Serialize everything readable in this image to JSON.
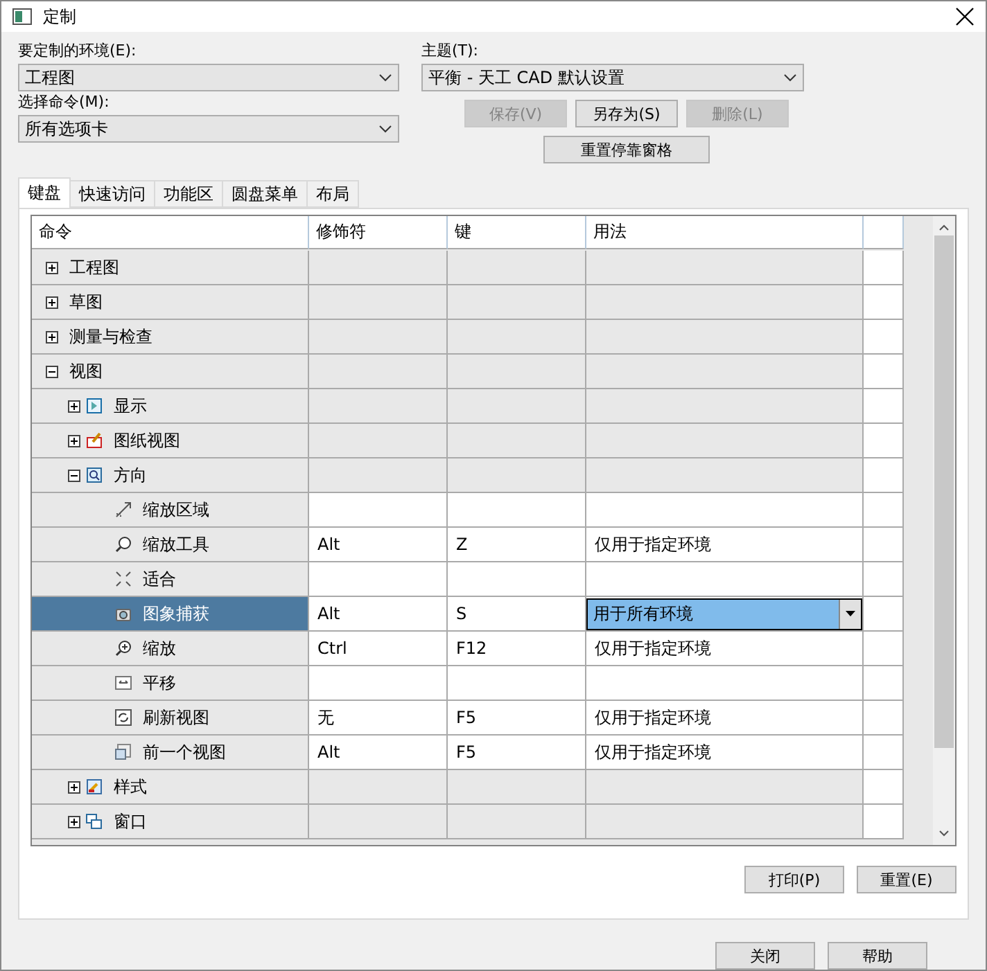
{
  "window": {
    "title": "定制"
  },
  "environment": {
    "label": "要定制的环境(E):",
    "value": "工程图"
  },
  "command_filter": {
    "label": "选择命令(M):",
    "value": "所有选项卡"
  },
  "theme": {
    "label": "主题(T):",
    "value": "平衡 - 天工 CAD 默认设置"
  },
  "theme_buttons": [
    {
      "label": "保存(V)",
      "disabled": true
    },
    {
      "label": "另存为(S)",
      "disabled": false
    },
    {
      "label": "删除(L)",
      "disabled": true
    }
  ],
  "reset_dock_button": "重置停靠窗格",
  "tabs": [
    {
      "label": "键盘",
      "selected": true
    },
    {
      "label": "快速访问",
      "selected": false
    },
    {
      "label": "功能区",
      "selected": false
    },
    {
      "label": "圆盘菜单",
      "selected": false
    },
    {
      "label": "布局",
      "selected": false
    }
  ],
  "table": {
    "columns": [
      "命令",
      "修饰符",
      "键",
      "用法"
    ],
    "tree": [
      {
        "label": "工程图",
        "expanded": false
      },
      {
        "label": "草图",
        "expanded": false
      },
      {
        "label": "测量与检查",
        "expanded": false
      },
      {
        "label": "视图",
        "expanded": true,
        "children": [
          {
            "label": "显示",
            "expanded": false
          },
          {
            "label": "图纸视图",
            "expanded": false
          },
          {
            "label": "方向",
            "expanded": true,
            "children": [
              {
                "label": "缩放区域",
                "selected": false
              },
              {
                "label": "缩放工具",
                "modifier": "Alt",
                "key": "Z",
                "usage": "仅用于指定环境",
                "selected": false
              },
              {
                "label": "适合",
                "selected": false
              },
              {
                "label": "图象捕获",
                "modifier": "Alt",
                "key": "S",
                "usage": "用于所有环境",
                "selected": true
              },
              {
                "label": "缩放",
                "modifier": "Ctrl",
                "key": "F12",
                "usage": "仅用于指定环境",
                "selected": false
              },
              {
                "label": "平移",
                "selected": false
              },
              {
                "label": "刷新视图",
                "modifier": "无",
                "key": "F5",
                "usage": "仅用于指定环境",
                "selected": false
              },
              {
                "label": "前一个视图",
                "modifier": "Alt",
                "key": "F5",
                "usage": "仅用于指定环境",
                "selected": false
              }
            ]
          },
          {
            "label": "样式",
            "expanded": false
          },
          {
            "label": "窗口",
            "expanded": false
          }
        ]
      }
    ]
  },
  "table_buttons": [
    "打印(P)",
    "重置(E)"
  ],
  "footer_buttons": [
    "关闭",
    "帮助"
  ]
}
